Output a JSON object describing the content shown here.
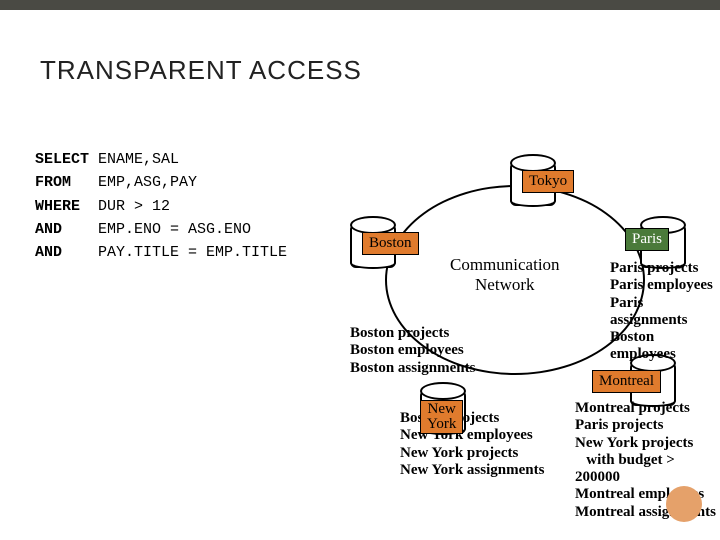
{
  "title": "TRANSPARENT ACCESS",
  "sql": {
    "select_kw": "SELECT",
    "select_v": " ENAME,SAL",
    "from_kw": "FROM",
    "from_v": "   EMP,ASG,PAY",
    "where_kw": "WHERE",
    "where_v": "  DUR > 12",
    "and1_kw": "AND",
    "and1_v": "    EMP.ENO = ASG.ENO",
    "and2_kw": "AND",
    "and2_v": "    PAY.TITLE = EMP.TITLE"
  },
  "network_label_l1": "Communication",
  "network_label_l2": "Network",
  "nodes": {
    "tokyo": "Tokyo",
    "boston": "Boston",
    "paris": "Paris",
    "montreal": "Montreal",
    "ny_l1": "New",
    "ny_l2": "York"
  },
  "paris_data": {
    "l1": "Paris projects",
    "l2": "Paris employees",
    "l3": "Paris assignments",
    "l4": "Boston employees"
  },
  "boston_data": {
    "l1": "Boston projects",
    "l2": "Boston employees",
    "l3": "Boston assignments"
  },
  "ny_data": {
    "l1": "Boston projects",
    "l2": "New York employees",
    "l3": "New York projects",
    "l4": "New York assignments"
  },
  "montreal_data": {
    "l1": "Montreal projects",
    "l2": "Paris projects",
    "l3": "New York projects",
    "l4": "   with budget > 200000",
    "l5": "Montreal employees",
    "l6": "Montreal assignments"
  }
}
